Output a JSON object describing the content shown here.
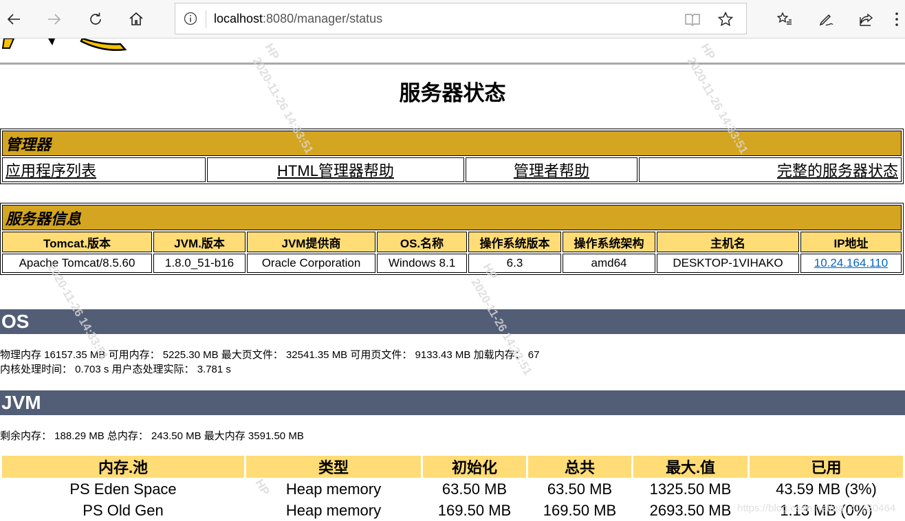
{
  "browser": {
    "url_host": "localhost",
    "url_rest": ":8080/manager/status"
  },
  "page": {
    "title": "服务器状态"
  },
  "manager": {
    "heading": "管理器",
    "links": [
      "应用程序列表",
      "HTML管理器帮助",
      "管理者帮助",
      "完整的服务器状态"
    ]
  },
  "server_info": {
    "heading": "服务器信息",
    "columns": [
      "Tomcat.版本",
      "JVM.版本",
      "JVM提供商",
      "OS.名称",
      "操作系统版本",
      "操作系统架构",
      "主机名",
      "IP地址"
    ],
    "values": [
      "Apache Tomcat/8.5.60",
      "1.8.0_51-b16",
      "Oracle Corporation",
      "Windows 8.1",
      "6.3",
      "amd64",
      "DESKTOP-1VIHAKO",
      "10.24.164.110"
    ]
  },
  "os": {
    "heading": "OS",
    "line1": "物理内存 16157.35 MB 可用内存： 5225.30 MB 最大页文件： 32541.35 MB 可用页文件： 9133.43 MB 加载内存： 67",
    "line2": "内核处理时间： 0.703 s 用户态处理实际： 3.781 s"
  },
  "jvm": {
    "heading": "JVM",
    "line": "剩余内存： 188.29 MB 总内存： 243.50 MB 最大内存 3591.50 MB",
    "columns": [
      "内存.池",
      "类型",
      "初始化",
      "总共",
      "最大.值",
      "已用"
    ],
    "rows": [
      [
        "PS Eden Space",
        "Heap memory",
        "63.50 MB",
        "63.50 MB",
        "1325.50 MB",
        "43.59 MB (3%)"
      ],
      [
        "PS Old Gen",
        "Heap memory",
        "169.50 MB",
        "169.50 MB",
        "2693.50 MB",
        "1.13 MB (0%)"
      ]
    ]
  },
  "watermarks": {
    "user": "HP",
    "stamp": "2020-11-26 14:33:51",
    "csdn": "https://blog.csdn.net/qq_40230464"
  },
  "colors": {
    "section_header": "#d4a520",
    "column_header": "#ffdc75",
    "band": "#525d76",
    "link": "#0563c1"
  }
}
